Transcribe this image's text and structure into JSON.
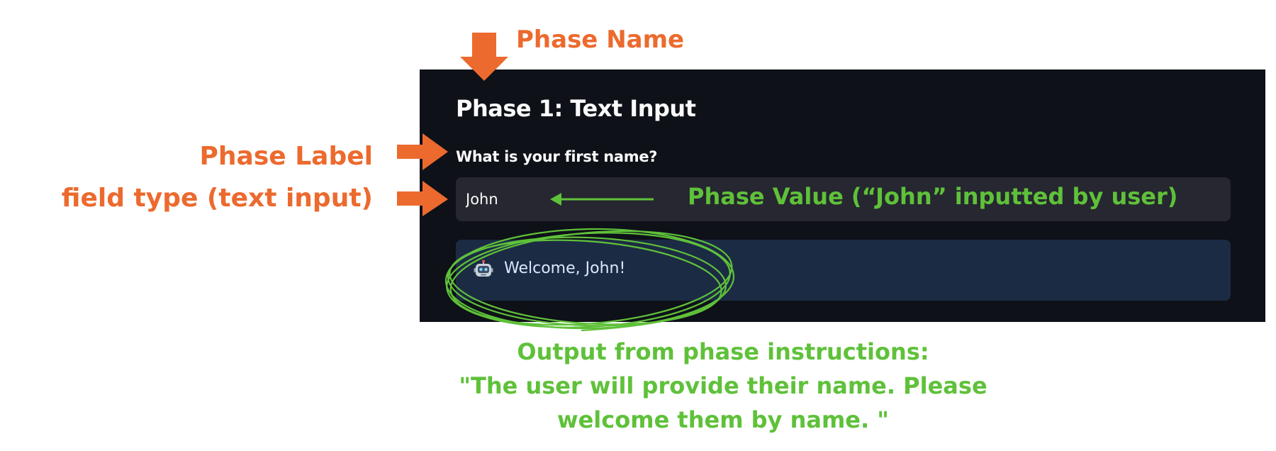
{
  "app": {
    "phase_title": "Phase 1: Text Input",
    "phase_label": "What is your first name?",
    "input_value": "John",
    "output_text": "Welcome, John!",
    "output_icon": "robot-icon"
  },
  "annotations": {
    "phase_name": "Phase Name",
    "phase_label": "Phase Label",
    "field_type": "field type (text input)",
    "phase_value": "Phase Value (“John” inputted by user)",
    "output_lines": [
      "Output from phase instructions:",
      "\"The user will provide their name. Please",
      "welcome them by name. \""
    ]
  },
  "colors": {
    "orange": "#ec6a2e",
    "green": "#5fc13a",
    "panel_bg": "#0e1118",
    "input_bg": "#262730",
    "output_bg": "#1c2b44"
  }
}
